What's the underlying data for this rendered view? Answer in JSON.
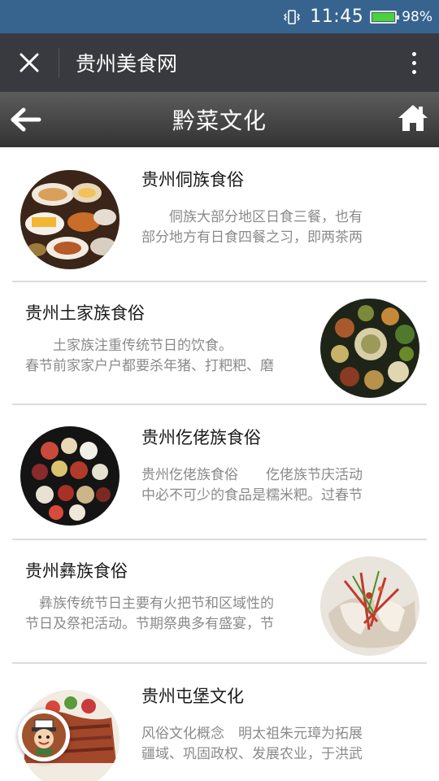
{
  "status_bar": {
    "time": "11:45",
    "battery_pct": "98%",
    "battery_level": 0.98
  },
  "app_header": {
    "title": "贵州美食网"
  },
  "page_nav": {
    "title": "黔菜文化"
  },
  "articles": [
    {
      "title": "贵州侗族食俗",
      "desc_line1": "　　侗族大部分地区日食三餐，也有",
      "desc_line2": "部分地方有日食四餐之习，即两茶两"
    },
    {
      "title": "贵州土家族食俗",
      "desc_line1": "　　土家族注重传统节日的饮食。",
      "desc_line2": "春节前家家户户都要杀年猪、打粑粑、磨"
    },
    {
      "title": "贵州仡佬族食俗",
      "desc_line1": "贵州仡佬族食俗　　仡佬族节庆活动",
      "desc_line2": "中必不可少的食品是糯米粑。过春节"
    },
    {
      "title": "贵州彝族食俗",
      "desc_line1": "　彝族传统节日主要有火把节和区域性的",
      "desc_line2": "节日及祭祀活动。节期祭典多有盛宴，节"
    },
    {
      "title": "贵州屯堡文化",
      "desc_line1": "风俗文化概念　明太祖朱元璋为拓展",
      "desc_line2": "疆域、巩固政权、发展农业，于洪武"
    }
  ]
}
